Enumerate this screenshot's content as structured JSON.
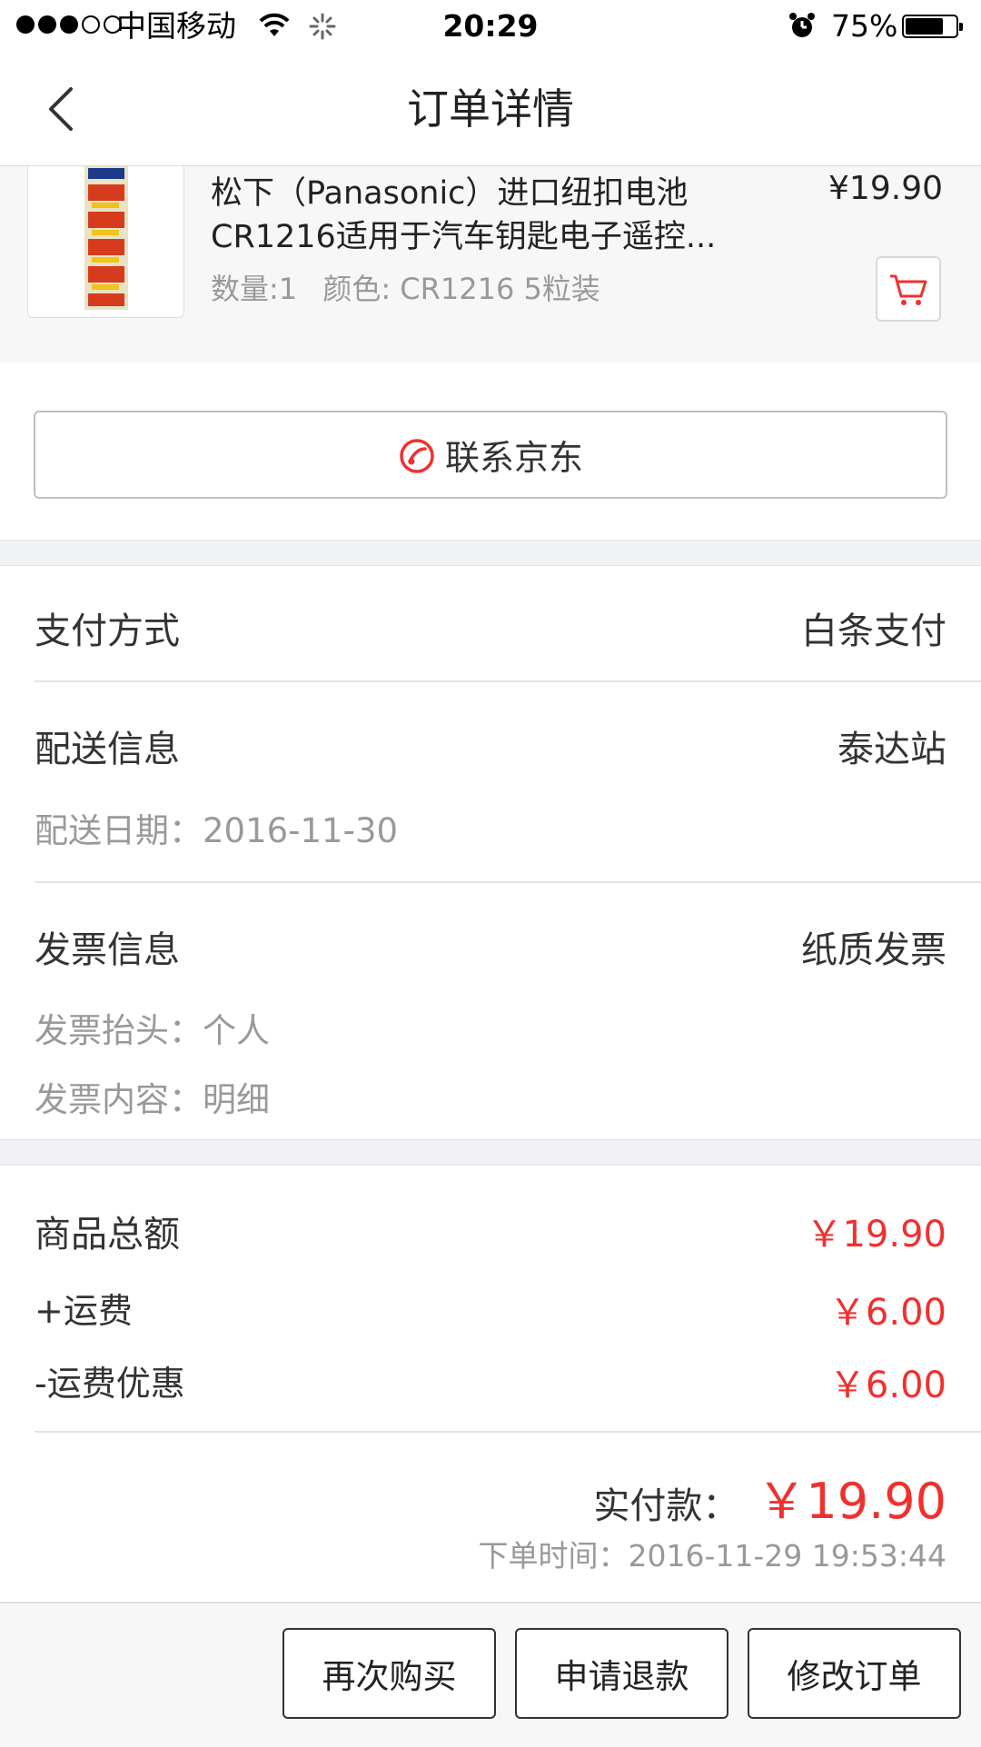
{
  "status_bar": {
    "carrier": "中国移动",
    "time": "20:29",
    "battery": "75%",
    "battery_level": 0.75
  },
  "nav": {
    "title": "订单详情"
  },
  "product": {
    "name": "松下（Panasonic）进口纽扣电池CR1216适用于汽车钥匙电子遥控...",
    "quantity": "数量:1",
    "color": "颜色: CR1216 5粒装",
    "price": "¥19.90"
  },
  "contact": {
    "label": "联系京东"
  },
  "payment": {
    "label": "支付方式",
    "value": "白条支付"
  },
  "delivery": {
    "label": "配送信息",
    "value": "泰达站",
    "date_label": "配送日期：",
    "date": "2016-11-30"
  },
  "invoice": {
    "label": "发票信息",
    "value": "纸质发票",
    "title_label": "发票抬头：",
    "title": "个人",
    "content_label": "发票内容：",
    "content": "明细"
  },
  "amounts": {
    "subtotal_label": "商品总额",
    "subtotal": "￥19.90",
    "shipping_label": "+运费",
    "shipping": "￥6.00",
    "discount_label": "-运费优惠",
    "discount": "￥6.00",
    "paid_label": "实付款：",
    "paid": "￥19.90",
    "order_time_label": "下单时间：",
    "order_time": "2016-11-29 19:53:44"
  },
  "actions": {
    "rebuy": "再次购买",
    "refund": "申请退款",
    "modify": "修改订单"
  },
  "colors": {
    "accent": "#f0302f",
    "divider": "#e3e3e3"
  }
}
